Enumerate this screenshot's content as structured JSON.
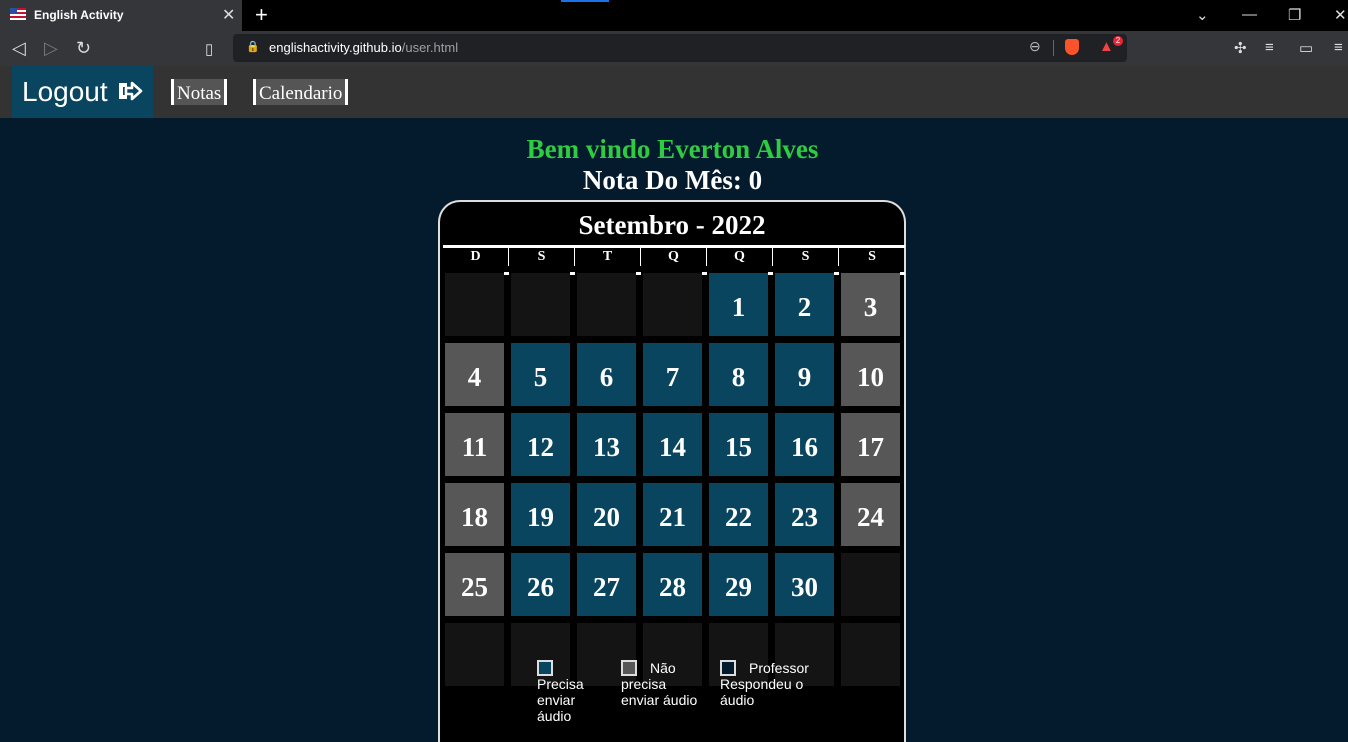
{
  "browser": {
    "tab_title": "English Activity",
    "new_tab": "+",
    "url_host": "englishactivity.github.io",
    "url_path": "/user.html",
    "rewards_count": "2"
  },
  "site": {
    "logout_label": "Logout",
    "nav": [
      "Notas",
      "Calendario"
    ],
    "welcome": "Bem vindo Everton Alves",
    "nota": "Nota Do Mês: 0"
  },
  "calendar": {
    "title": "Setembro - 2022",
    "weekdays": [
      "D",
      "S",
      "T",
      "Q",
      "Q",
      "S",
      "S"
    ],
    "rows": [
      [
        {
          "n": "",
          "s": "empty"
        },
        {
          "n": "",
          "s": "empty"
        },
        {
          "n": "",
          "s": "empty"
        },
        {
          "n": "",
          "s": "empty"
        },
        {
          "n": "1",
          "s": "blue"
        },
        {
          "n": "2",
          "s": "blue"
        },
        {
          "n": "3",
          "s": "gray"
        }
      ],
      [
        {
          "n": "4",
          "s": "gray"
        },
        {
          "n": "5",
          "s": "blue"
        },
        {
          "n": "6",
          "s": "blue"
        },
        {
          "n": "7",
          "s": "blue"
        },
        {
          "n": "8",
          "s": "blue"
        },
        {
          "n": "9",
          "s": "blue"
        },
        {
          "n": "10",
          "s": "gray"
        }
      ],
      [
        {
          "n": "11",
          "s": "gray"
        },
        {
          "n": "12",
          "s": "blue"
        },
        {
          "n": "13",
          "s": "blue"
        },
        {
          "n": "14",
          "s": "blue"
        },
        {
          "n": "15",
          "s": "blue"
        },
        {
          "n": "16",
          "s": "blue"
        },
        {
          "n": "17",
          "s": "gray"
        }
      ],
      [
        {
          "n": "18",
          "s": "gray"
        },
        {
          "n": "19",
          "s": "blue"
        },
        {
          "n": "20",
          "s": "blue"
        },
        {
          "n": "21",
          "s": "blue"
        },
        {
          "n": "22",
          "s": "blue"
        },
        {
          "n": "23",
          "s": "blue"
        },
        {
          "n": "24",
          "s": "gray"
        }
      ],
      [
        {
          "n": "25",
          "s": "gray"
        },
        {
          "n": "26",
          "s": "blue"
        },
        {
          "n": "27",
          "s": "blue"
        },
        {
          "n": "28",
          "s": "blue"
        },
        {
          "n": "29",
          "s": "blue"
        },
        {
          "n": "30",
          "s": "blue"
        },
        {
          "n": "",
          "s": "empty"
        }
      ],
      [
        {
          "n": "",
          "s": "empty"
        },
        {
          "n": "",
          "s": "empty"
        },
        {
          "n": "",
          "s": "empty"
        },
        {
          "n": "",
          "s": "empty"
        },
        {
          "n": "",
          "s": "empty"
        },
        {
          "n": "",
          "s": "empty"
        },
        {
          "n": "",
          "s": "empty"
        }
      ]
    ],
    "legend": [
      {
        "lines": [
          "",
          "Precisa",
          "enviar",
          "áudio"
        ],
        "color": "#0a4560"
      },
      {
        "lines": [
          "Não",
          "precisa",
          "enviar áudio"
        ],
        "color": "#575757"
      },
      {
        "lines": [
          "Professor",
          "Respondeu o",
          "áudio"
        ],
        "color": "#041b2e"
      }
    ]
  },
  "colors": {
    "page_bg": "#041b2e",
    "blue_day": "#0a4560",
    "gray_day": "#575757",
    "empty_day": "#141414",
    "welcome": "#2ecc40"
  }
}
